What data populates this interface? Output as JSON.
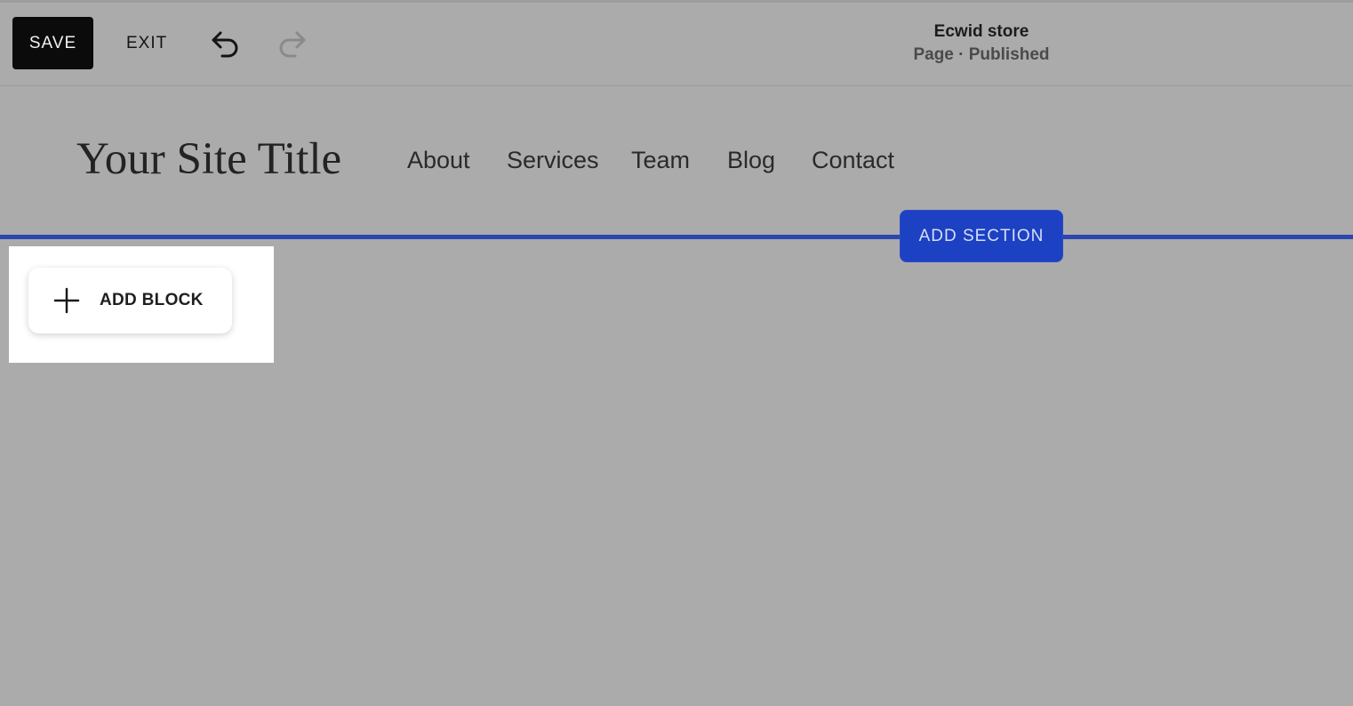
{
  "toolbar": {
    "save_label": "SAVE",
    "exit_label": "EXIT",
    "undo_icon": "undo-icon",
    "redo_icon": "redo-icon"
  },
  "store": {
    "name": "Ecwid store",
    "status": "Page · Published"
  },
  "site": {
    "title": "Your Site Title",
    "nav": [
      {
        "label": "About"
      },
      {
        "label": "Services"
      },
      {
        "label": "Team"
      },
      {
        "label": "Blog"
      },
      {
        "label": "Contact"
      }
    ]
  },
  "editor": {
    "add_section_label": "ADD SECTION",
    "add_block_label": "ADD BLOCK",
    "add_block_icon": "plus-icon"
  },
  "colors": {
    "overlay_gray": "#ababab",
    "save_bg": "#0b0b0b",
    "accent_blue": "#1c41c2",
    "section_line": "#2a46b0"
  }
}
